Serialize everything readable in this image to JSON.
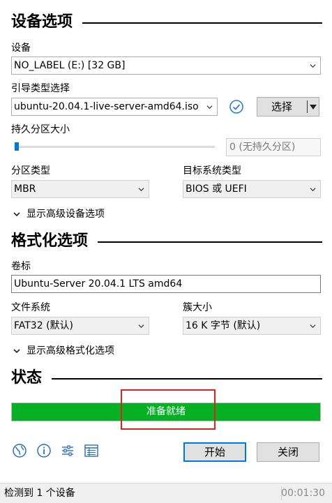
{
  "device_section": {
    "title": "设备选项",
    "device_label": "设备",
    "device_value": "NO_LABEL (E:) [32 GB]",
    "boot_label": "引导类型选择",
    "boot_value": "ubuntu-20.04.1-live-server-amd64.iso",
    "select_button": "选择",
    "persistent_label": "持久分区大小",
    "persistent_value": "0 (无持久分区)",
    "persistent_level": 0,
    "partition_label": "分区类型",
    "partition_value": "MBR",
    "target_label": "目标系统类型",
    "target_value": "BIOS 或 UEFI",
    "advanced_toggle": "显示高级设备选项"
  },
  "format_section": {
    "title": "格式化选项",
    "volume_label": "卷标",
    "volume_value": "Ubuntu-Server 20.04.1 LTS amd64",
    "fs_label": "文件系统",
    "fs_value": "FAT32 (默认)",
    "cluster_label": "簇大小",
    "cluster_value": "16 K 字节 (默认)",
    "advanced_toggle": "显示高级格式化选项"
  },
  "status_section": {
    "title": "状态",
    "progress_text": "准备就绪",
    "progress_fraction": 1.0,
    "progress_color": "#06b025",
    "highlight_color": "#e0201b"
  },
  "toolbar": {
    "icons": [
      "globe-icon",
      "info-icon",
      "settings-icon",
      "log-icon"
    ],
    "start_label": "开始",
    "close_label": "关闭"
  },
  "statusbar": {
    "message": "检测到 1 个设备",
    "timer": "00:01:30"
  },
  "colors": {
    "accent": "#0078d7",
    "icon_blue": "#2b6fb6",
    "check_blue": "#2f7ccf"
  }
}
